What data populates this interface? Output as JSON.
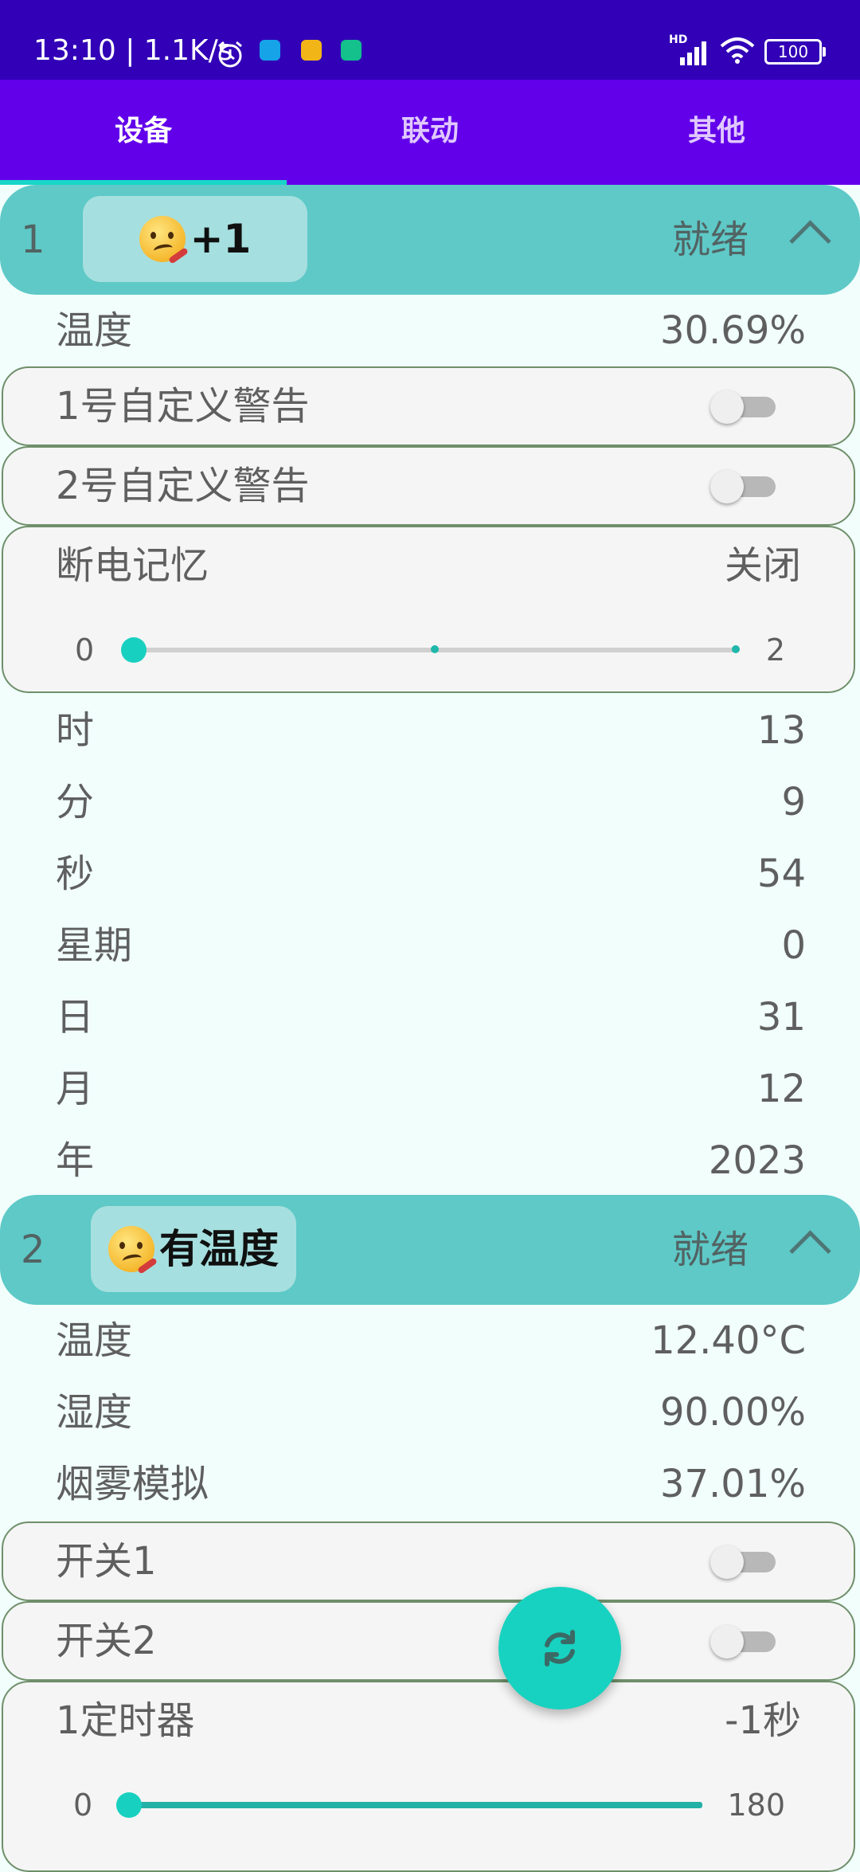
{
  "status_bar": {
    "time": "13:10 | 1.1K/s",
    "battery": "100",
    "signal_label": "HD"
  },
  "tabs": [
    {
      "label": "设备",
      "active": true
    },
    {
      "label": "联动",
      "active": false
    },
    {
      "label": "其他",
      "active": false
    }
  ],
  "device1": {
    "index": "1",
    "name": "+1",
    "status": "就绪",
    "temp_label": "温度",
    "temp_value": "30.69%",
    "alert1_label": "1号自定义警告",
    "alert1_on": false,
    "alert2_label": "2号自定义警告",
    "alert2_on": false,
    "memory_label": "断电记忆",
    "memory_value": "关闭",
    "memory_slider": {
      "min": "0",
      "max": "2",
      "value": 0
    },
    "time_rows": [
      {
        "label": "时",
        "value": "13"
      },
      {
        "label": "分",
        "value": "9"
      },
      {
        "label": "秒",
        "value": "54"
      },
      {
        "label": "星期",
        "value": "0"
      },
      {
        "label": "日",
        "value": "31"
      },
      {
        "label": "月",
        "value": "12"
      },
      {
        "label": "年",
        "value": "2023"
      }
    ]
  },
  "device2": {
    "index": "2",
    "name": "有温度",
    "status": "就绪",
    "rows": [
      {
        "label": "温度",
        "value": "12.40°C"
      },
      {
        "label": "湿度",
        "value": "90.00%"
      },
      {
        "label": "烟雾模拟",
        "value": "37.01%"
      }
    ],
    "switch1_label": "开关1",
    "switch1_on": false,
    "switch2_label": "开关2",
    "switch2_on": false,
    "timer_label": "1定时器",
    "timer_value": "-1秒",
    "timer_slider": {
      "min": "0",
      "max": "180",
      "value": 0
    }
  },
  "colors": {
    "statusbar": "#3100b7",
    "tabbar": "#6200ea",
    "accent": "#18d6c8",
    "header": "#5ec9c7",
    "background": "#f1fefc"
  },
  "fab_icon": "refresh-icon"
}
